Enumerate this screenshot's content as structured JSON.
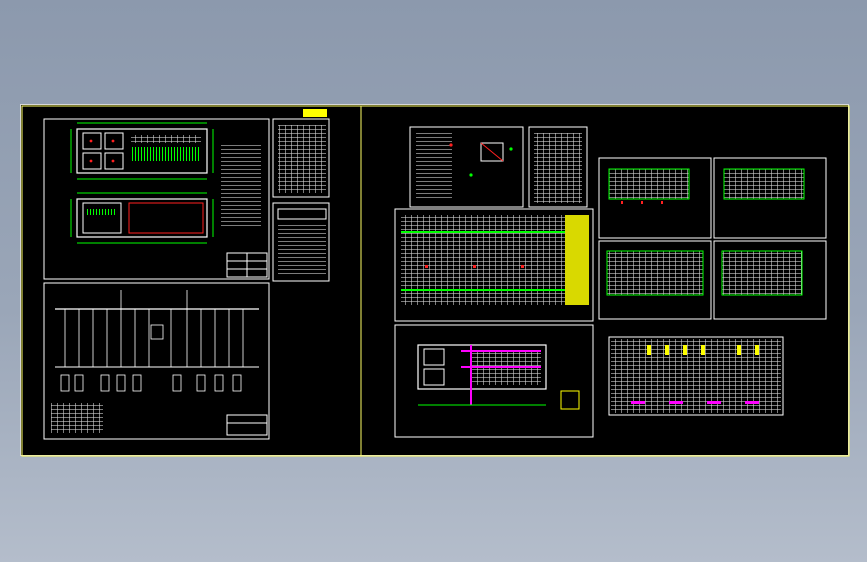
{
  "window": {
    "title": ""
  },
  "viewport": {
    "background": "#000000",
    "frame_color": "#ffff66",
    "sheet_color": "#ffffff",
    "accent_colors": {
      "green": "#00ff00",
      "red": "#ff2020",
      "magenta": "#ff00ff",
      "yellow": "#ffff00",
      "cyan": "#00ffff"
    }
  },
  "drawing_sheets": [
    {
      "id": "floor-plan-sheet",
      "kind": "floor plans with legend"
    },
    {
      "id": "schedule-sheet-1",
      "kind": "text schedule"
    },
    {
      "id": "schedule-sheet-2",
      "kind": "text schedule"
    },
    {
      "id": "single-line-diagram-sheet",
      "kind": "electrical single line diagram"
    },
    {
      "id": "detail-sheet",
      "kind": "detail drawing"
    },
    {
      "id": "notes-sheet",
      "kind": "notes table"
    },
    {
      "id": "panel-schedule-sheet",
      "kind": "panel schedule table"
    },
    {
      "id": "plan-sheet-2",
      "kind": "floor plan with magenta routing"
    },
    {
      "id": "small-table-1",
      "kind": "table"
    },
    {
      "id": "small-table-2",
      "kind": "table"
    },
    {
      "id": "small-table-3",
      "kind": "table"
    },
    {
      "id": "small-table-4",
      "kind": "table"
    },
    {
      "id": "switchgear-table",
      "kind": "switchgear table"
    }
  ]
}
